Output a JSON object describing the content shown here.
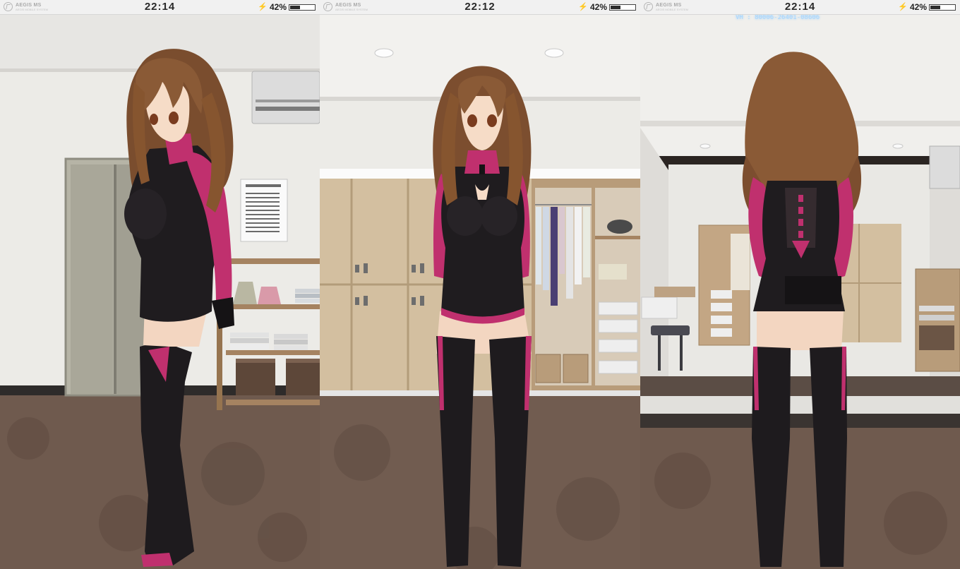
{
  "app": {
    "logo_text": "AEGIS MS",
    "logo_sub": "AEGIS MOBILE SYSTEM"
  },
  "panels": [
    {
      "clock": "22:14",
      "battery": {
        "percent_label": "42%",
        "level": 0.42
      },
      "view": "side"
    },
    {
      "clock": "22:12",
      "battery": {
        "percent_label": "42%",
        "level": 0.42
      },
      "view": "front",
      "overlay_lines": []
    },
    {
      "clock": "22:14",
      "battery": {
        "percent_label": "42%",
        "level": 0.42
      },
      "view": "back",
      "overlay_lines": [
        "VH : 80006-26401-08606"
      ]
    }
  ],
  "colors": {
    "status_bg": "#f1f1f1",
    "hair": "#8a5a36",
    "suit_black": "#1f1c1f",
    "suit_magenta": "#c0306e",
    "skin": "#f6dcc7",
    "floor": "#6f5a4e",
    "wall": "#ecebe7"
  },
  "icons": [
    "aegis-logo-icon",
    "charging-bolt-icon",
    "battery-icon"
  ]
}
